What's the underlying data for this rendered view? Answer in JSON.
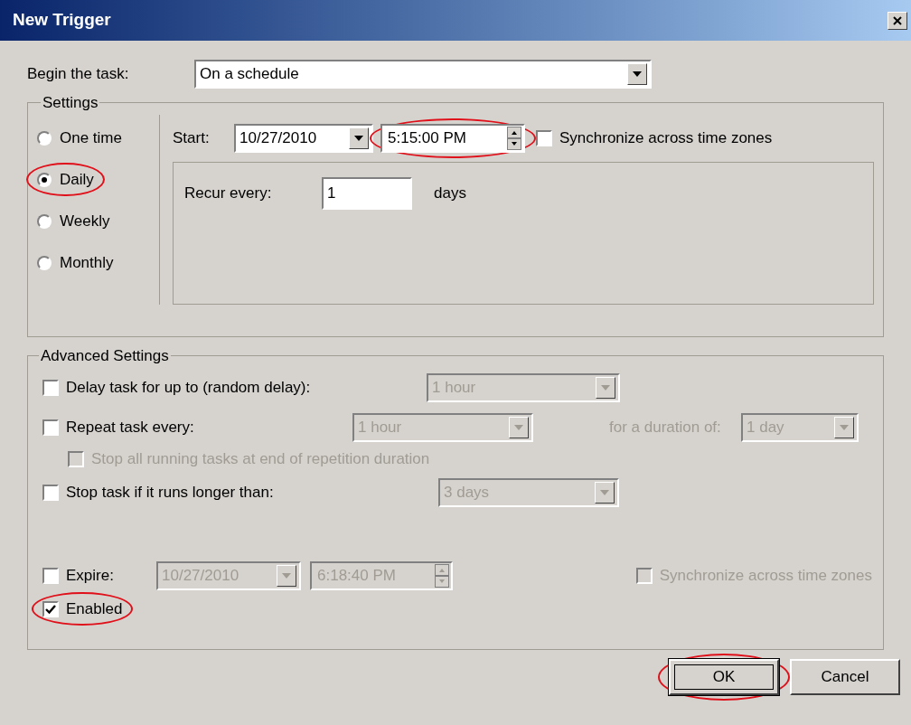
{
  "window": {
    "title": "New Trigger"
  },
  "begin_task": {
    "label": "Begin the task:",
    "value": "On a schedule"
  },
  "settings": {
    "title": "Settings",
    "schedule_options": [
      {
        "label": "One time",
        "selected": false,
        "highlighted": false
      },
      {
        "label": "Daily",
        "selected": true,
        "highlighted": true
      },
      {
        "label": "Weekly",
        "selected": false,
        "highlighted": false
      },
      {
        "label": "Monthly",
        "selected": false,
        "highlighted": false
      }
    ],
    "start": {
      "label": "Start:",
      "date": "10/27/2010",
      "time": "5:15:00 PM",
      "time_highlighted": true,
      "sync": {
        "label": "Synchronize across time zones",
        "checked": false,
        "disabled": false
      }
    },
    "recur": {
      "label": "Recur every:",
      "value": "1",
      "unit": "days"
    }
  },
  "advanced": {
    "title": "Advanced Settings",
    "delay": {
      "label": "Delay task for up to (random delay):",
      "checked": false,
      "value": "1 hour",
      "disabled": true
    },
    "repeat": {
      "label": "Repeat task every:",
      "checked": false,
      "value": "1 hour",
      "disabled": true,
      "duration_label": "for a duration of:",
      "duration_value": "1 day"
    },
    "stop_all": {
      "label": "Stop all running tasks at end of repetition duration",
      "checked": false,
      "disabled": true
    },
    "stop_long": {
      "label": "Stop task if it runs longer than:",
      "checked": false,
      "value": "3 days",
      "disabled": true
    },
    "expire": {
      "label": "Expire:",
      "checked": false,
      "date": "10/27/2010",
      "time": "6:18:40 PM",
      "disabled": true,
      "sync": {
        "label": "Synchronize across time zones",
        "checked": false,
        "disabled": true
      }
    },
    "enabled": {
      "label": "Enabled",
      "checked": true,
      "highlighted": true
    }
  },
  "buttons": [
    {
      "label": "OK",
      "default": true,
      "highlighted": true
    },
    {
      "label": "Cancel",
      "default": false,
      "highlighted": false
    }
  ]
}
